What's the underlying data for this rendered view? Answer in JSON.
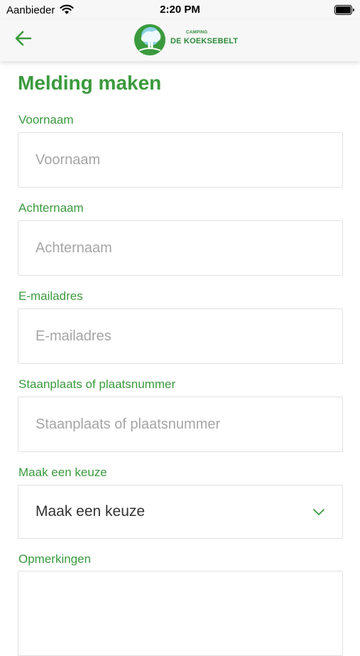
{
  "status_bar": {
    "carrier": "Aanbieder",
    "time": "2:20 PM"
  },
  "header": {
    "logo_small": "CAMPING",
    "logo_big": "DE KOEKSEBELT"
  },
  "form": {
    "title": "Melding maken",
    "fields": [
      {
        "label": "Voornaam",
        "placeholder": "Voornaam"
      },
      {
        "label": "Achternaam",
        "placeholder": "Achternaam"
      },
      {
        "label": "E-mailadres",
        "placeholder": "E-mailadres"
      },
      {
        "label": "Staanplaats of plaatsnummer",
        "placeholder": "Staanplaats of plaatsnummer"
      }
    ],
    "select": {
      "label": "Maak een keuze",
      "value": "Maak een keuze"
    },
    "remarks": {
      "label": "Opmerkingen"
    }
  },
  "colors": {
    "accent": "#3a9a3d",
    "brand": "#2b8a3a"
  }
}
